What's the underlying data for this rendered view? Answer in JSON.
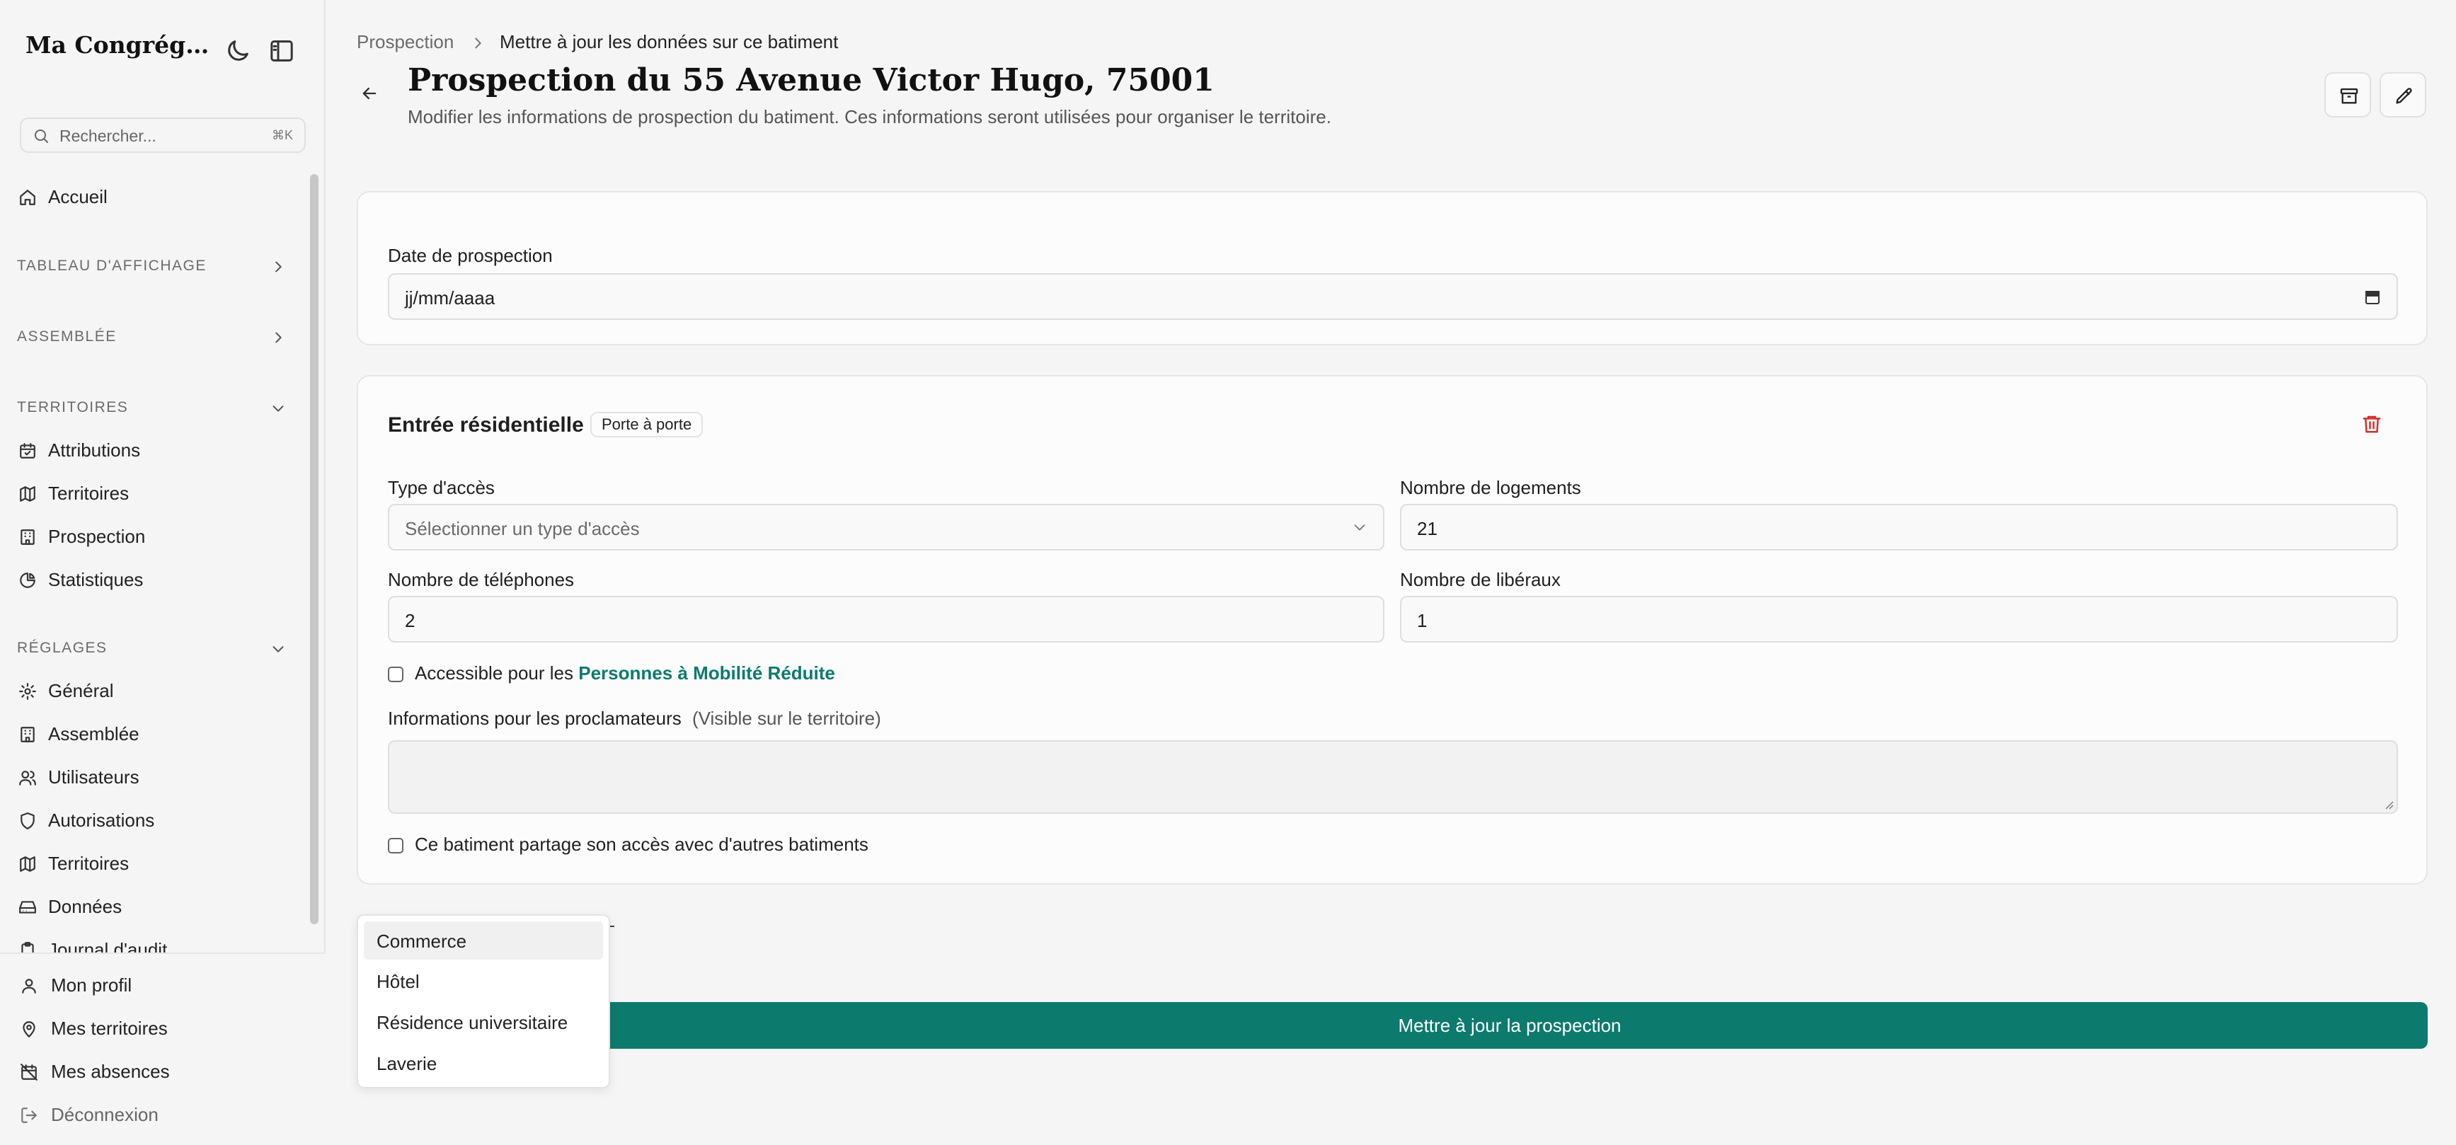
{
  "sidebar": {
    "brand": "Ma Congrégation",
    "search_placeholder": "Rechercher...",
    "search_shortcut": "⌘K",
    "home": "Accueil",
    "sections": {
      "board": "TABLEAU D'AFFICHAGE",
      "assembly": "ASSEMBLÉE",
      "territories": "TERRITOIRES",
      "settings": "RÉGLAGES"
    },
    "territory_items": [
      "Attributions",
      "Territoires",
      "Prospection",
      "Statistiques"
    ],
    "settings_items": [
      "Général",
      "Assemblée",
      "Utilisateurs",
      "Autorisations",
      "Territoires",
      "Données",
      "Journal d'audit"
    ],
    "bottom_items": [
      "Mon profil",
      "Mes territoires",
      "Mes absences"
    ],
    "logout": "Déconnexion"
  },
  "breadcrumb": {
    "parent": "Prospection",
    "current": "Mettre à jour les données sur ce batiment"
  },
  "header": {
    "title": "Prospection du 55 Avenue Victor Hugo, 75001",
    "subtitle": "Modifier les informations de prospection du batiment. Ces informations seront utilisées pour organiser le territoire."
  },
  "date_card": {
    "label": "Date de prospection",
    "value": "jj/mm/aaaa"
  },
  "entry_card": {
    "title": "Entrée résidentielle",
    "badge": "Porte à porte",
    "access_type_label": "Type d'accès",
    "access_type_placeholder": "Sélectionner un type d'accès",
    "housing_label": "Nombre de logements",
    "housing_value": "21",
    "phones_label": "Nombre de téléphones",
    "phones_value": "2",
    "liberal_label": "Nombre de libéraux",
    "liberal_value": "1",
    "accessible_prefix": "Accessible pour les",
    "accessible_link": "Personnes à Mobilité Réduite",
    "info_label": "Informations pour les proclamateurs",
    "info_hint": "(Visible sur le territoire)",
    "shared_access": "Ce batiment partage son accès avec d'autres batiments"
  },
  "dropdown": {
    "options": [
      "Commerce",
      "Hôtel",
      "Résidence universitaire",
      "Laverie"
    ]
  },
  "submit_label": "Mettre à jour la prospection",
  "colors": {
    "accent": "#0d7a6e",
    "danger": "#d32f2f",
    "background": "#f5f5f5"
  }
}
